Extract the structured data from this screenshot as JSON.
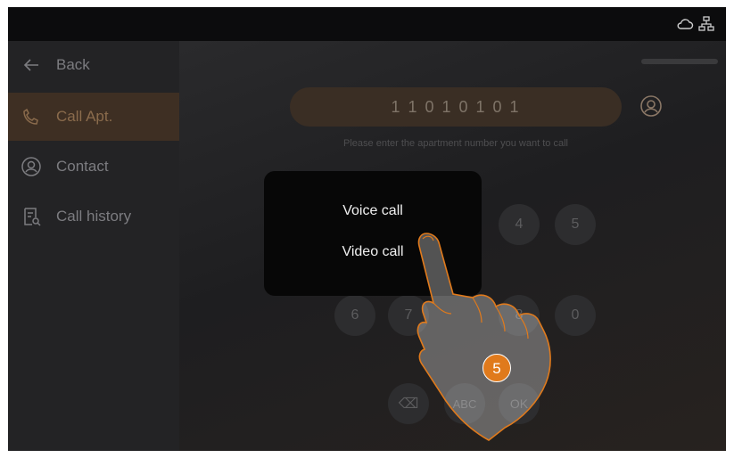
{
  "status_bar": {
    "icons": [
      "cloud-icon",
      "network-icon"
    ]
  },
  "sidebar": {
    "items": [
      {
        "label": "Back",
        "icon": "back-arrow-icon"
      },
      {
        "label": "Call Apt.",
        "icon": "phone-icon",
        "active": true
      },
      {
        "label": "Contact",
        "icon": "contact-icon"
      },
      {
        "label": "Call history",
        "icon": "call-history-icon"
      }
    ]
  },
  "main": {
    "apartment_number": "1 1 0 1 0 1 0 1",
    "hint": "Please enter the apartment number you want to call",
    "keypad": {
      "row1": [
        "4",
        "5"
      ],
      "row2": [
        "6",
        "7",
        "8",
        "0"
      ],
      "row3": [
        "⌫",
        "ABC",
        "OK"
      ]
    }
  },
  "popup": {
    "voice_call": "Voice call",
    "video_call": "Video call"
  },
  "instruction": {
    "step": "5"
  },
  "colors": {
    "accent": "#e07a1c",
    "active_bg": "#3e2f23",
    "screen_bg": "#1b1b1d"
  }
}
